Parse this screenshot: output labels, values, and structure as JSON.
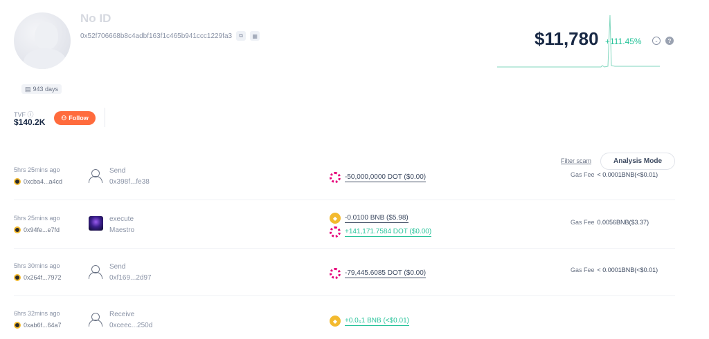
{
  "profile": {
    "name": "No ID",
    "address": "0x52f706668b8c4adbf163f1c465b941ccc1229fa3",
    "copy_icon": "copy-icon",
    "qr_icon": "qr-icon",
    "age": "943 days",
    "tvf_label": "TVF",
    "tvf_value": "$140.2K",
    "follow_label": "Follow"
  },
  "portfolio": {
    "total": "$11,780",
    "change": "+111.45%",
    "change_color": "#27c39a"
  },
  "history": {
    "filter_label": "Filter scam",
    "analysis_label": "Analysis Mode",
    "gas_label": "Gas Fee",
    "rows": [
      {
        "time": "5hrs 25mins ago",
        "chain_addr": "0xcba4...a4cd",
        "method": "Send",
        "peer": "0x398f...fe38",
        "tokens": [
          {
            "amount": "-50,000,0000 DOT ($0.00)",
            "icon": "dot-icon"
          }
        ],
        "gas": "< 0.0001BNB(<$0.01)"
      },
      {
        "time": "5hrs 25mins ago",
        "chain_addr": "0x94fe...e7fd",
        "method": "execute",
        "peer": "Maestro",
        "tokens": [
          {
            "amount": "-0.0100 BNB ($5.98)",
            "icon": "bnb-icon"
          },
          {
            "amount": "+141,171.7584 DOT ($0.00)",
            "icon": "dot-icon"
          }
        ],
        "gas": "0.0056BNB($3.37)"
      },
      {
        "time": "5hrs 30mins ago",
        "chain_addr": "0x264f...7972",
        "method": "Send",
        "peer": "0xf169...2d97",
        "tokens": [
          {
            "amount": "-79,445.6085 DOT ($0.00)",
            "icon": "dot-icon"
          }
        ],
        "gas": "< 0.0001BNB(<$0.01)"
      },
      {
        "time": "6hrs 32mins ago",
        "chain_addr": "0xab6f...64a7",
        "method": "Receive",
        "peer": "0xceec...250d",
        "tokens": [
          {
            "amount": "+0.0₆1 BNB (<$0.01)",
            "icon": "bnb-icon"
          }
        ],
        "gas": ""
      }
    ]
  }
}
